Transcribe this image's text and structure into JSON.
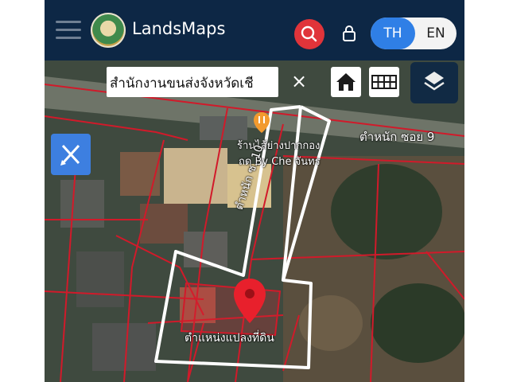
{
  "header": {
    "brand": "LandsMaps",
    "lang_th": "TH",
    "lang_en": "EN",
    "icons": [
      "menu-icon",
      "logo",
      "search-icon",
      "lock-icon"
    ]
  },
  "search": {
    "value": "สำนักงานขนส่งจังหวัดเชี",
    "clear": "×"
  },
  "map": {
    "labels": {
      "street_top": "ตำหนัก ซอย 9",
      "poi_line1": "ร้านไส้ย่างปากกอง",
      "poi_line2": "ถด By Che จันทร",
      "road_diag": "ตำหนัก ซ. 10",
      "bottom": "ตำแหน่งแปลงที่ดิน"
    },
    "controls": [
      "home-icon",
      "grid-icon",
      "layers-icon",
      "draw-icon"
    ]
  },
  "colors": {
    "header_bg": "#0d2745",
    "accent_blue": "#2f7fe6",
    "search_red": "#e0343a",
    "parcel_line": "#d11a2a",
    "pin": "#e8202c"
  }
}
